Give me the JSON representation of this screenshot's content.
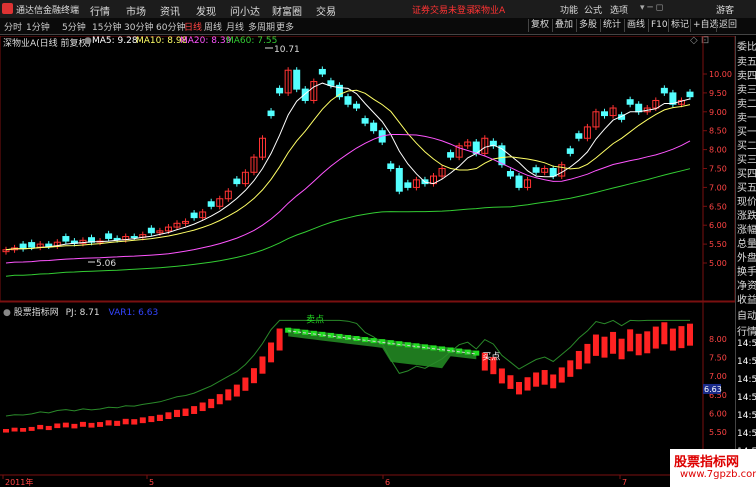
{
  "menubar": {
    "app_name": "通达信金融终端",
    "items": [
      "行情",
      "市场",
      "资讯",
      "发现",
      "问小达",
      "财富圈",
      "交易"
    ],
    "notice": "证券交易未登录",
    "stock_tag": "深物业A",
    "right_items": [
      "功能",
      "公式",
      "选项",
      "游客"
    ]
  },
  "toolbar": {
    "periods": [
      "分时",
      "1分钟",
      "5分钟",
      "15分钟",
      "30分钟",
      "60分钟",
      "日线",
      "周线",
      "月线",
      "多周期",
      "更多"
    ],
    "active_period": "日线",
    "buttons": [
      "复权",
      "叠加",
      "多股",
      "统计",
      "画线",
      "F10",
      "标记",
      "+自选",
      "返回"
    ]
  },
  "chart": {
    "title": "深物业A(日线 前复权)",
    "ma5": "MA5: 9.28",
    "ma10": "MA10: 8.98",
    "ma20": "MA20: 8.39",
    "ma60": "MA60: 7.55",
    "high_label": "10.71",
    "low_label": "5.06",
    "price_ticks": [
      "10.00",
      "9.50",
      "9.00",
      "8.50",
      "8.00",
      "7.50",
      "7.00",
      "6.50",
      "6.00",
      "5.50",
      "5.00"
    ],
    "x_labels": [
      "2011年",
      "5",
      "6",
      "7"
    ]
  },
  "indicator": {
    "title": "股票指标网",
    "pj": "PJ: 8.71",
    "var1": "VAR1: 6.63",
    "sell_label": "卖点",
    "buy_label": "买点",
    "ticks": [
      "8.00",
      "7.50",
      "7.00",
      "6.50",
      "6.00",
      "5.50"
    ],
    "current_value": "6.63"
  },
  "right_panel": [
    "委比",
    "卖五",
    "卖四",
    "卖三",
    "卖二",
    "卖一",
    "买一",
    "买二",
    "买三",
    "买四",
    "买五",
    "现价",
    "涨跌",
    "涨幅",
    "总量",
    "外盘",
    "换手",
    "净资",
    "收益",
    "自动",
    "行情",
    "14:50",
    "14:50",
    "14:50",
    "14:50",
    "14:50",
    "14:50",
    "14:50",
    "14:50",
    "14:50",
    "14:50"
  ],
  "watermark": {
    "line1": "股票指标网",
    "line2": "www.7gpzb.com"
  },
  "colors": {
    "up": "#ff3333",
    "down": "#54ffff",
    "ma5": "#ffffff",
    "ma10": "#ffff66",
    "ma20": "#ff55ff",
    "ma60": "#33cc33",
    "active": "#ff4444"
  }
}
